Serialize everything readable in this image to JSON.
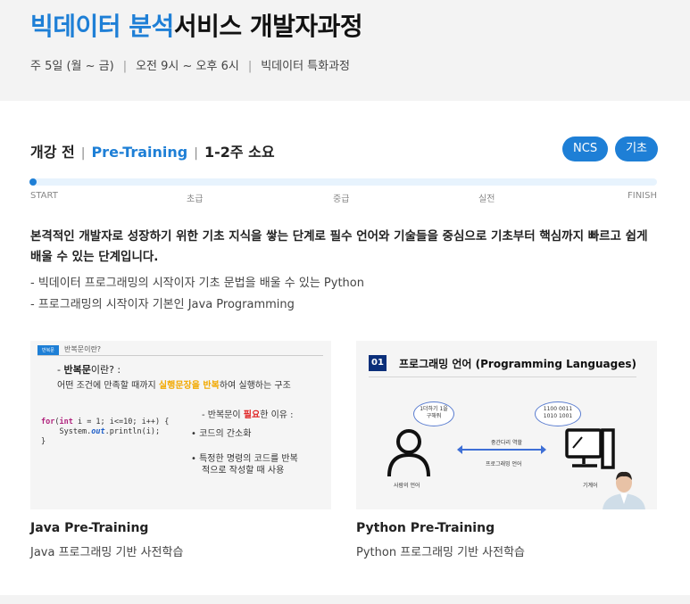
{
  "header": {
    "title_blue": "빅데이터 분석",
    "title_rest": "서비스 개발자과정",
    "meta": [
      "주 5일 (월 ~ 금)",
      "오전 9시 ~ 오후 6시",
      "빅데이터 특화과정"
    ],
    "meta_separator": "|"
  },
  "stage": {
    "phase": "개강 전",
    "name": "Pre-Training",
    "duration": "1-2주 소요",
    "separator": "|",
    "badges": [
      "NCS",
      "기초"
    ]
  },
  "progress": {
    "steps": [
      "START",
      "초급",
      "중급",
      "실전",
      "FINISH"
    ],
    "current_index": 0
  },
  "description": "본격적인 개발자로 성장하기 위한 기초 지식을 쌓는 단계로 필수 언어와 기술들을 중심으로 기초부터 핵심까지 빠르고 쉽게 배울 수 있는 단계입니다.",
  "bullets": [
    "-  빅데이터 프로그래밍의 시작이자 기초 문법을 배울 수 있는 Python",
    "-  프로그래밍의 시작이자 기본인 Java Programming"
  ],
  "cards": [
    {
      "title": "Java Pre-Training",
      "subtitle": "Java 프로그래밍 기반 사전학습",
      "thumb": {
        "tag": "반복문",
        "tag_title": "반복문이란?",
        "heading_prefix": "- ",
        "heading_bold": "반복문",
        "heading_rest": "이란? :",
        "line_a": "어떤 조건에 만족할 때까지 ",
        "line_hl": "실행문장을 반복",
        "line_b": "하여 실행하는 구조",
        "why_a": "- 반복문이 ",
        "why_red": "필요",
        "why_b": "한 이유 :",
        "li1": "•  코드의 간소화",
        "li2a": "•  특정한 명령의 코드를 반복",
        "li2b": "적으로 작성할 때 사용",
        "code_for": "for",
        "code_int": "int",
        "code_rest1": " i = 1; i<=10; i++) {",
        "code_sys": "    System.",
        "code_out": "out",
        "code_rest2": ".println(i);",
        "code_close": "}"
      }
    },
    {
      "title": "Python Pre-Training",
      "subtitle": "Python 프로그래밍 기반 사전학습",
      "thumb": {
        "num": "01",
        "title": "프로그래밍 언어 (Programming Languages)",
        "bubble_left": [
          "1더하기 1을",
          "구해줘"
        ],
        "bubble_right": [
          "1100 0011",
          "1010 1001"
        ],
        "label_human": "사람의 언어",
        "label_machine": "기계어",
        "label_bridge": "중간다리 역할",
        "label_lang": "프로그래밍 언어"
      }
    }
  ],
  "colors": {
    "accent": "#1e7fd6",
    "highlight": "#f2a900",
    "navy": "#0b2f7a"
  }
}
